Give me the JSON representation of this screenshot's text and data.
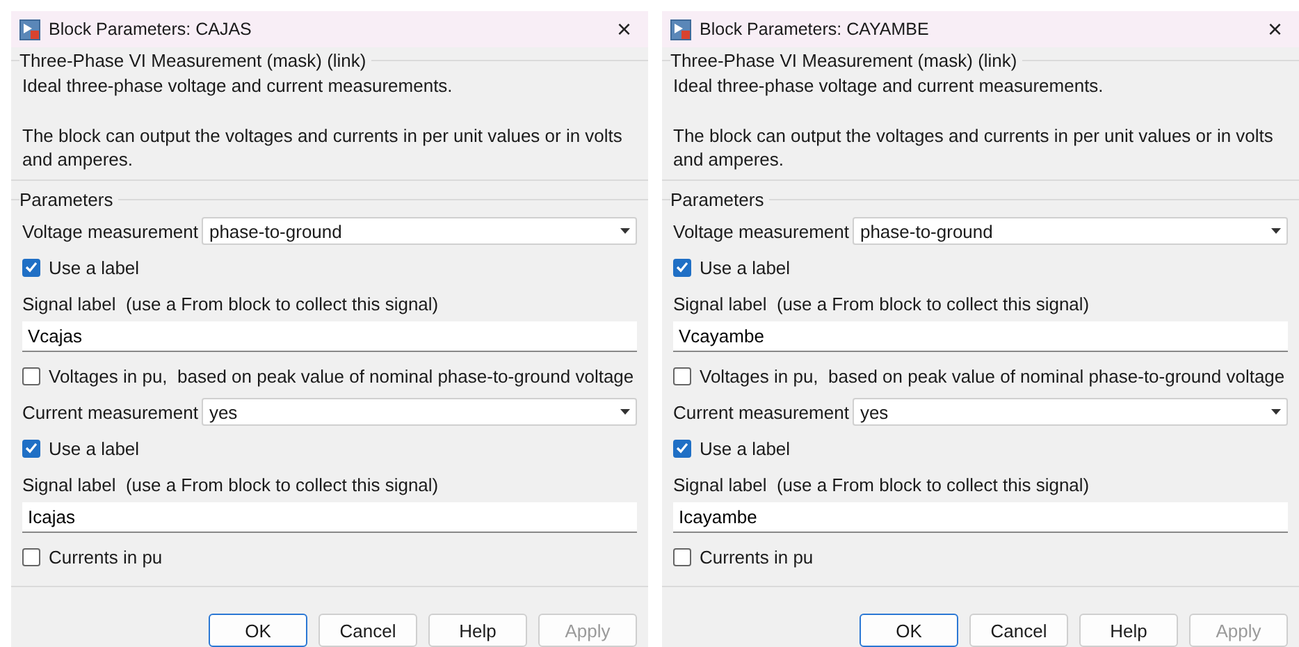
{
  "dialogs": [
    {
      "title": "Block Parameters: CAJAS",
      "close": "×",
      "mask_title": "Three-Phase VI Measurement (mask) (link)",
      "description": [
        "Ideal three-phase voltage and current measurements.",
        "The block can output the voltages and currents in per unit values or in volts and amperes."
      ],
      "parameters_title": "Parameters",
      "params": [
        {
          "kind": "select",
          "label": "Voltage measurement",
          "value": "phase-to-ground"
        },
        {
          "kind": "checkbox",
          "label": "Use a label",
          "checked": true
        },
        {
          "kind": "text",
          "label": "Signal label  (use a From block to collect this signal)",
          "value": "Vcajas"
        },
        {
          "kind": "checkbox",
          "label": "Voltages in pu,  based on peak value of nominal phase-to-ground voltage",
          "checked": false
        },
        {
          "kind": "select",
          "label": "Current measurement",
          "value": "yes"
        },
        {
          "kind": "checkbox",
          "label": "Use a label",
          "checked": true
        },
        {
          "kind": "text",
          "label": "Signal label  (use a From block to collect this signal)",
          "value": "Icajas"
        },
        {
          "kind": "checkbox",
          "label": "Currents in pu",
          "checked": false
        }
      ],
      "buttons": [
        {
          "label": "OK",
          "disabled": false,
          "focused": true
        },
        {
          "label": "Cancel",
          "disabled": false,
          "focused": false
        },
        {
          "label": "Help",
          "disabled": false,
          "focused": false
        },
        {
          "label": "Apply",
          "disabled": true,
          "focused": false
        }
      ]
    },
    {
      "title": "Block Parameters: CAYAMBE",
      "close": "×",
      "mask_title": "Three-Phase VI Measurement (mask) (link)",
      "description": [
        "Ideal three-phase voltage and current measurements.",
        "The block can output the voltages and currents in per unit values or in volts and amperes."
      ],
      "parameters_title": "Parameters",
      "params": [
        {
          "kind": "select",
          "label": "Voltage measurement",
          "value": "phase-to-ground"
        },
        {
          "kind": "checkbox",
          "label": "Use a label",
          "checked": true
        },
        {
          "kind": "text",
          "label": "Signal label  (use a From block to collect this signal)",
          "value": "Vcayambe"
        },
        {
          "kind": "checkbox",
          "label": "Voltages in pu,  based on peak value of nominal phase-to-ground voltage",
          "checked": false
        },
        {
          "kind": "select",
          "label": "Current measurement",
          "value": "yes"
        },
        {
          "kind": "checkbox",
          "label": "Use a label",
          "checked": true
        },
        {
          "kind": "text",
          "label": "Signal label  (use a From block to collect this signal)",
          "value": "Icayambe"
        },
        {
          "kind": "checkbox",
          "label": "Currents in pu",
          "checked": false
        }
      ],
      "buttons": [
        {
          "label": "OK",
          "disabled": false,
          "focused": true
        },
        {
          "label": "Cancel",
          "disabled": false,
          "focused": false
        },
        {
          "label": "Help",
          "disabled": false,
          "focused": false
        },
        {
          "label": "Apply",
          "disabled": true,
          "focused": false
        }
      ]
    }
  ]
}
